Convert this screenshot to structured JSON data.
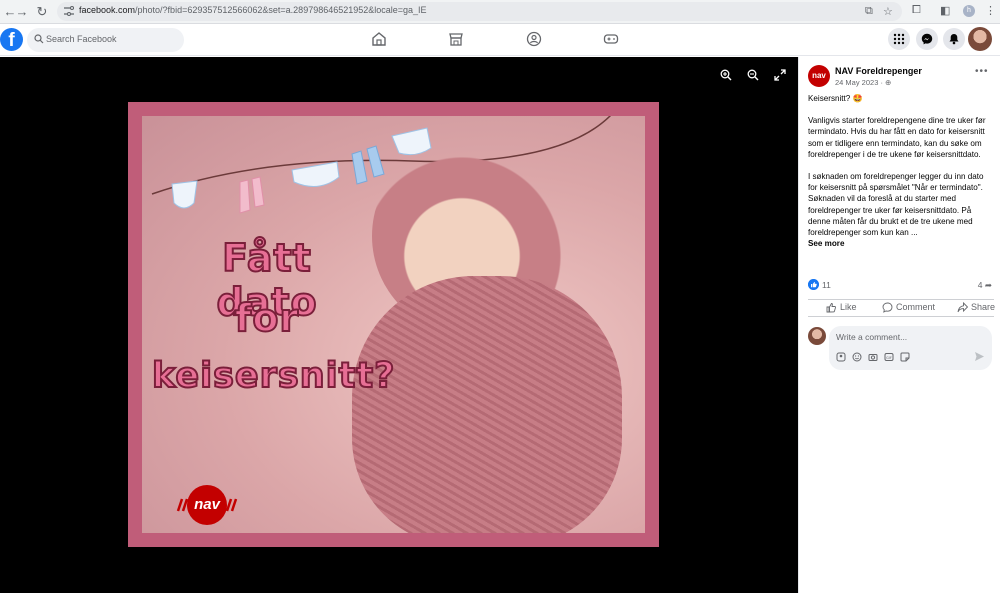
{
  "browser": {
    "url_host": "facebook.com",
    "url_path": "/photo/?fbid=629357512566062&set=a.289798646521952&locale=ga_IE",
    "profile_initial": "h"
  },
  "facebook": {
    "logo": "f",
    "search_placeholder": "Search Facebook"
  },
  "photo": {
    "line1": "Fått dato",
    "line2": "for",
    "line3": "keisersnitt?",
    "logo_text": "nav"
  },
  "post": {
    "page_avatar_text": "nav",
    "page_name": "NAV Foreldrepenger",
    "date": "24 May 2023 · ",
    "title": "Keisersnitt? 🤩",
    "paragraph1": "Vanligvis starter foreldrepengene dine tre uker før termindato. Hvis du har fått en dato for keisersnitt som er tidligere enn termindato, kan du søke om foreldrepenger i de tre ukene før keisersnittdato.",
    "paragraph2": "I søknaden om foreldrepenger legger du inn dato for keisersnitt på spørsmålet \"Når er termindato\". Søknaden vil da foreslå at du starter med foreldrepenger tre uker før keisersnittdato. På denne måten får du brukt et de tre ukene med foreldrepenger som kun kan ...",
    "see_more": "See more",
    "reaction_count": "11",
    "share_count": "4",
    "like_label": "Like",
    "comment_label": "Comment",
    "share_label": "Share",
    "comment_placeholder": "Write a comment..."
  },
  "colors": {
    "facebook_blue": "#1877f2",
    "nav_red": "#c30000",
    "photo_frame": "#c05d79"
  }
}
